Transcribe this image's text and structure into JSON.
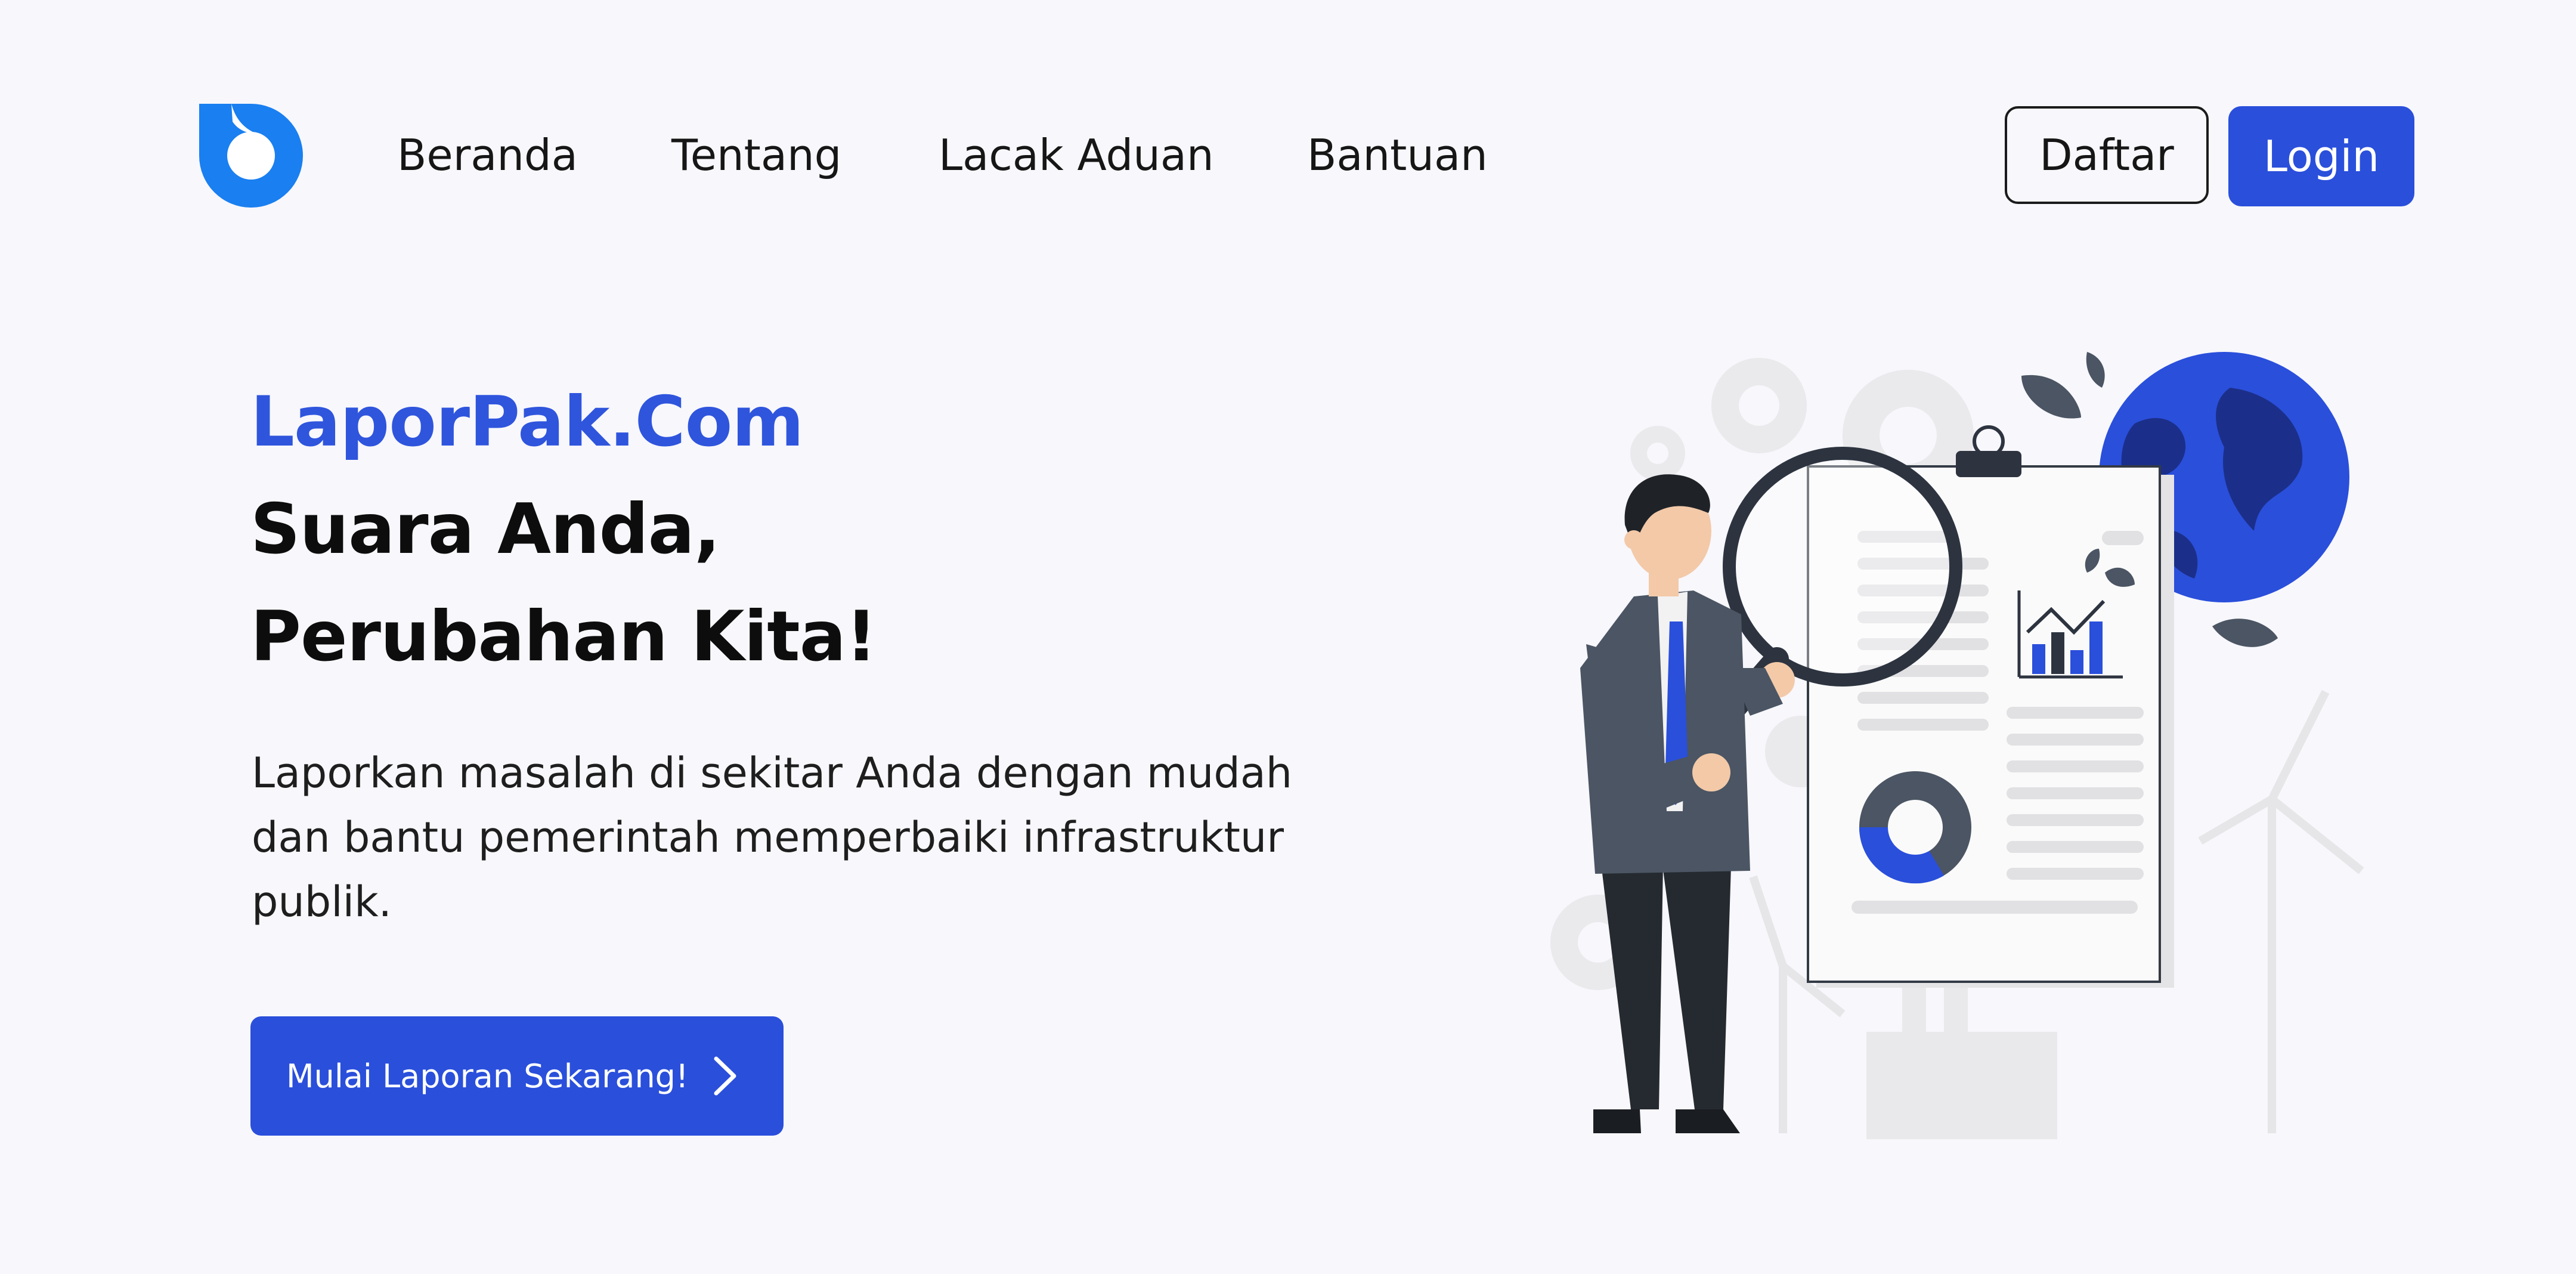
{
  "header": {
    "logo_icon": "droplet-logo-icon",
    "nav": [
      {
        "label": "Beranda"
      },
      {
        "label": "Tentang"
      },
      {
        "label": "Lacak Aduan"
      },
      {
        "label": "Bantuan"
      }
    ],
    "register_label": "Daftar",
    "login_label": "Login"
  },
  "hero": {
    "brand": "LaporPak.Com",
    "headline_line1": "Suara Anda,",
    "headline_line2": "Perubahan Kita!",
    "description": "Laporkan masalah di sekitar Anda dengan mudah dan bantu pemerintah memperbaiki infrastruktur publik.",
    "cta_label": "Mulai Laporan Sekarang!",
    "cta_icon": "chevron-right-icon"
  },
  "illustration": {
    "icon": "man-with-magnifier-report-illustration"
  },
  "colors": {
    "accent": "#2a4fdb",
    "brand_text": "#2f55dd",
    "background": "#f7f7fc",
    "logo": "#1a7ff0"
  }
}
